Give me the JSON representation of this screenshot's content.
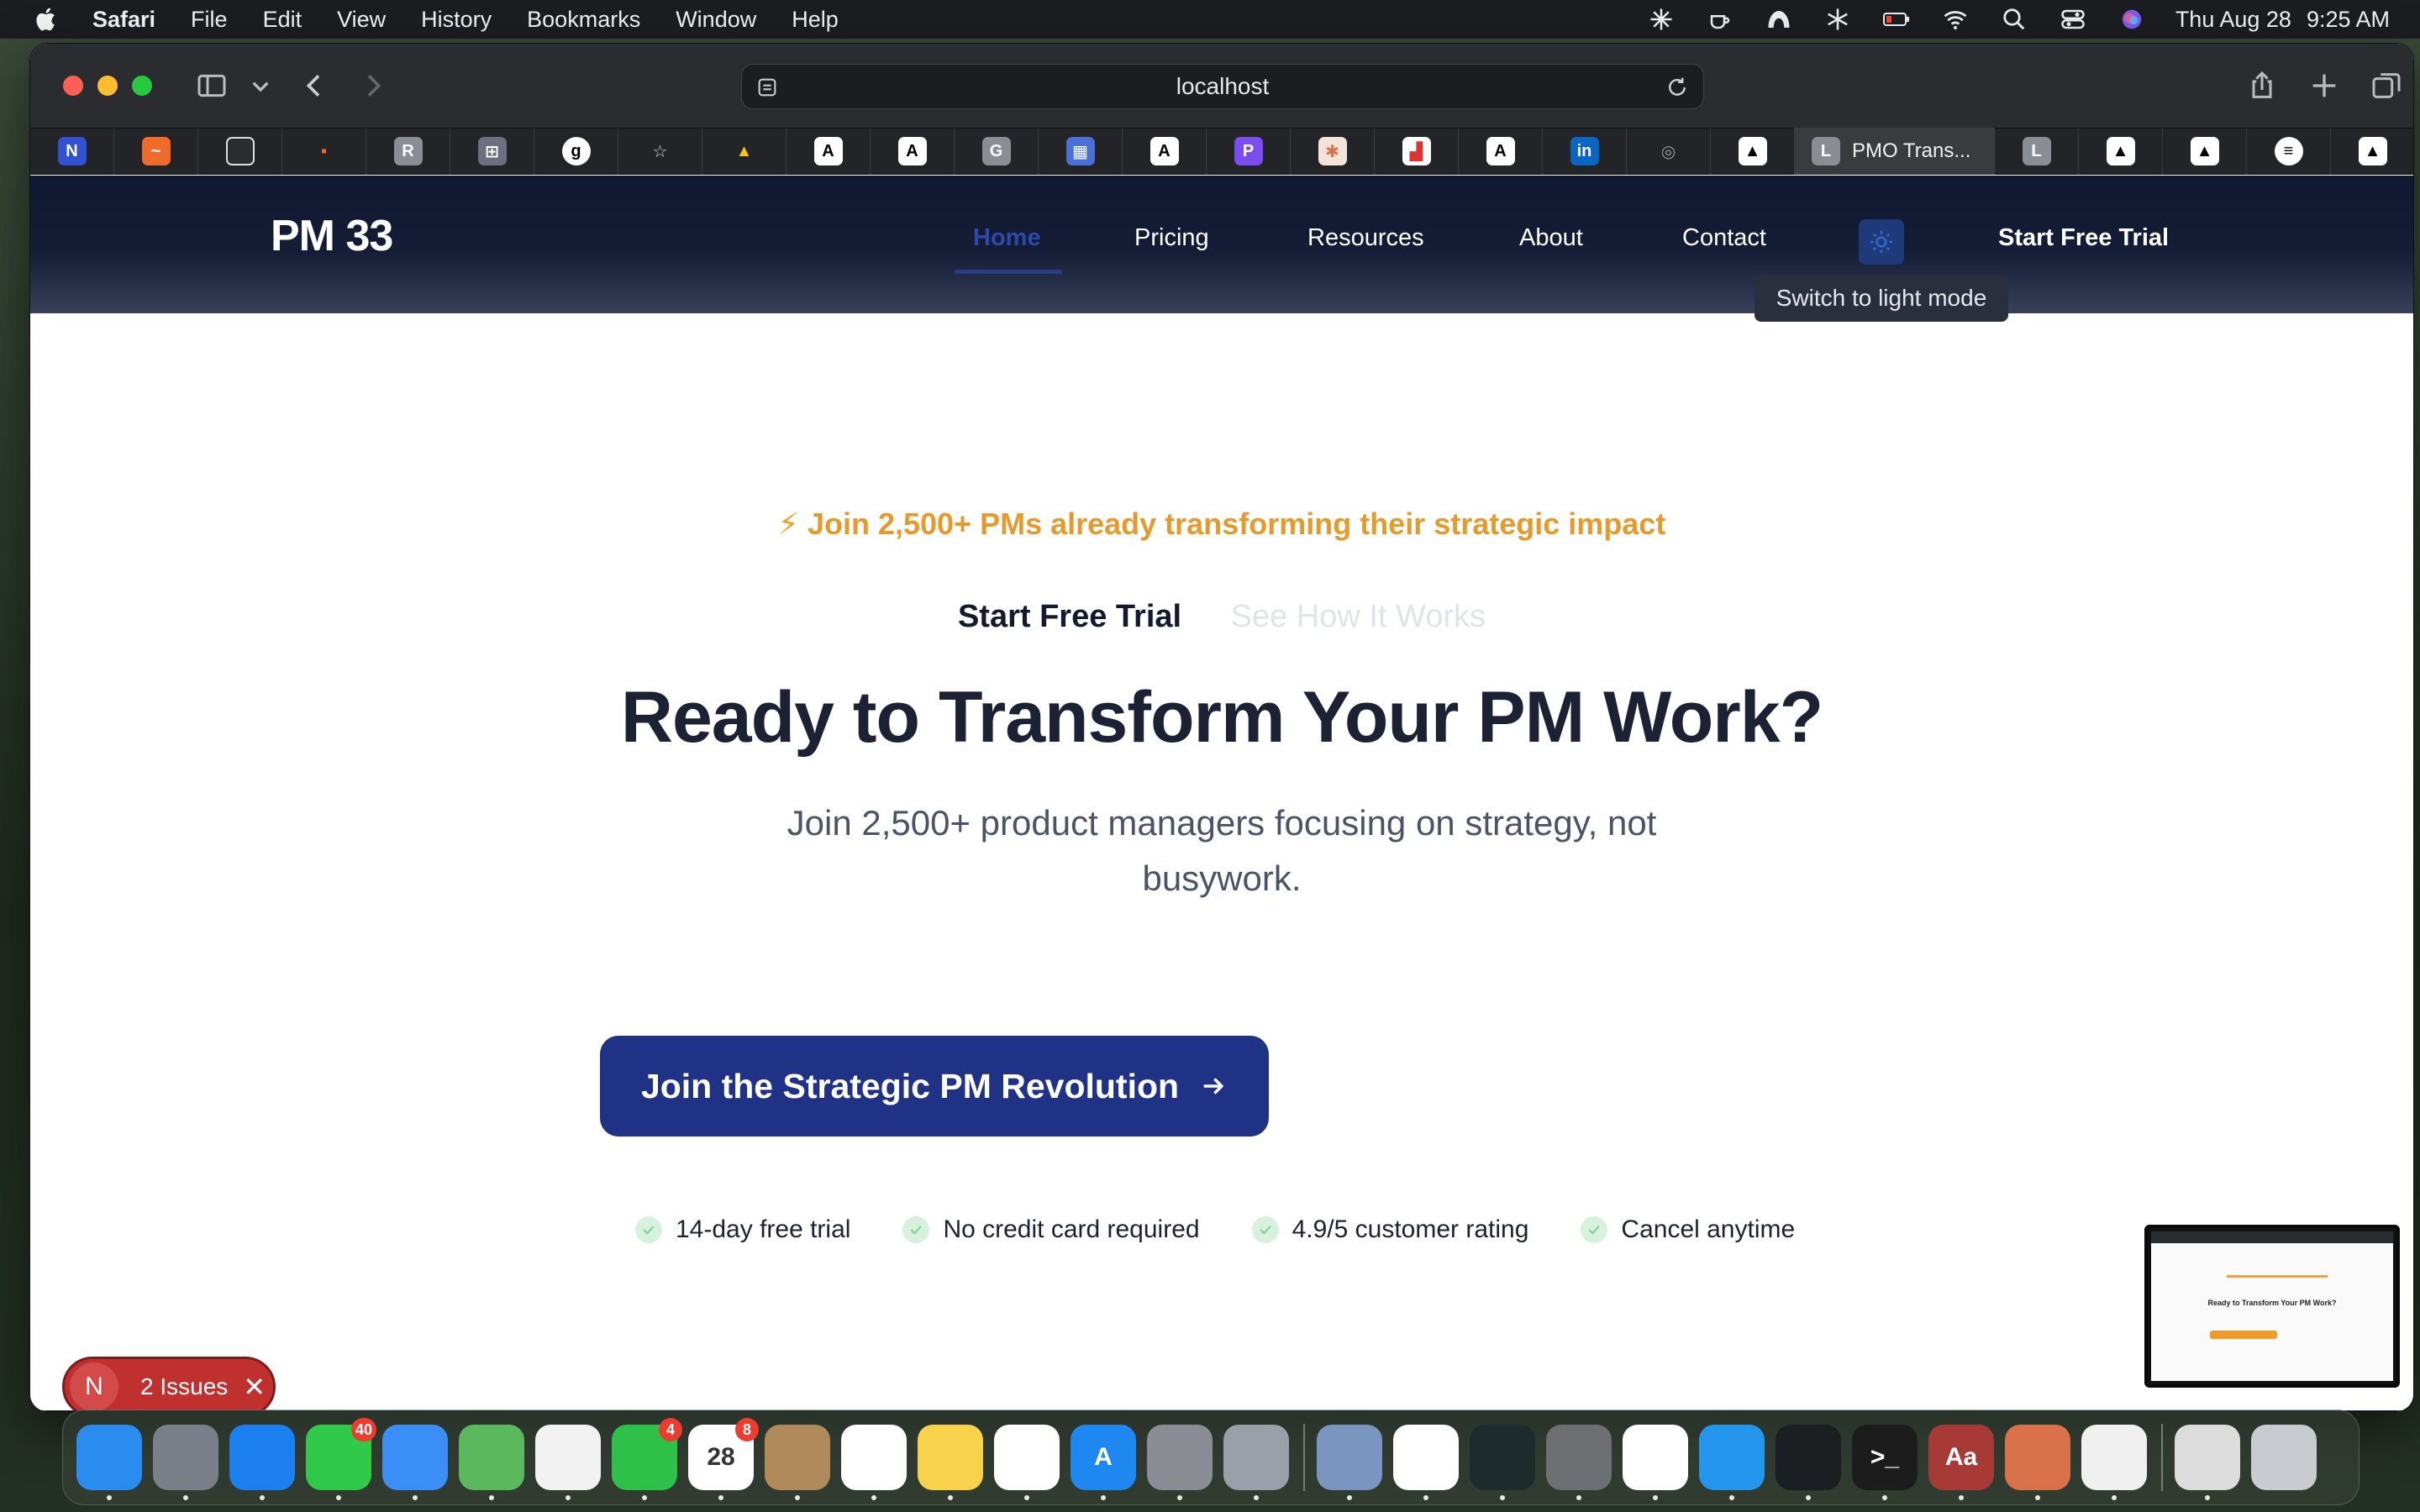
{
  "menubar": {
    "app_name": "Safari",
    "menus": [
      "File",
      "Edit",
      "View",
      "History",
      "Bookmarks",
      "Window",
      "Help"
    ],
    "status_icons": [
      "sparkle-icon",
      "coffee-icon",
      "arch-icon",
      "snowflake-icon",
      "battery-icon",
      "wifi-icon",
      "search-icon",
      "control-center-icon",
      "siri-icon"
    ],
    "date": "Thu Aug 28",
    "time": "9:25 AM"
  },
  "browser": {
    "url": "localhost",
    "active_tab_label": "PMO Trans...",
    "favorites_icons": [
      "n-icon",
      "zig-icon",
      "scan-icon",
      "dots-icon",
      "r-icon",
      "grid-icon",
      "g-icon",
      "star-icon",
      "drive-icon",
      "a-icon",
      "a-icon",
      "g-gray-icon",
      "blocks-icon",
      "a-icon",
      "p-icon",
      "burst-icon",
      "chart-icon",
      "a-icon",
      "linkedin-icon",
      "compass-icon",
      "triangle-icon",
      "l-icon",
      "triangle-icon",
      "triangle-icon",
      "spotify-icon",
      "triangle-icon"
    ]
  },
  "site": {
    "logo": "PM 33",
    "nav": {
      "home": "Home",
      "pricing": "Pricing",
      "resources": "Resources",
      "about": "About",
      "contact": "Contact",
      "cta": "Start Free Trial"
    },
    "tooltip": "Switch to light mode"
  },
  "hero": {
    "banner": "Join 2,500+ PMs already transforming their strategic impact",
    "banner_icon": "lightning-icon",
    "link_trial": "Start Free Trial",
    "link_how": "See How It Works",
    "title": "Ready to Transform Your PM Work?",
    "subtitle": "Join 2,500+ product managers focusing on strategy, not busywork.",
    "cta": "Join the Strategic PM Revolution",
    "features": [
      "14-day free trial",
      "No credit card required",
      "4.9/5 customer rating",
      "Cancel anytime"
    ]
  },
  "devtools": {
    "letter": "N",
    "issues": "2 Issues"
  },
  "dock": {
    "apps": [
      {
        "name": "finder",
        "color": "#2b8cf0",
        "label": ""
      },
      {
        "name": "launchpad",
        "color": "#7a7f8a",
        "label": ""
      },
      {
        "name": "safari",
        "color": "#1c7ff0",
        "label": ""
      },
      {
        "name": "messages",
        "color": "#30c94a",
        "label": "",
        "badge": "40"
      },
      {
        "name": "mail",
        "color": "#3b8ef5",
        "label": ""
      },
      {
        "name": "maps",
        "color": "#5cb85c",
        "label": ""
      },
      {
        "name": "photos",
        "color": "#f2f2f2",
        "label": ""
      },
      {
        "name": "facetime",
        "color": "#2fc04a",
        "label": "",
        "badge": "4"
      },
      {
        "name": "calendar",
        "color": "#ffffff",
        "label": "28",
        "badge": "8"
      },
      {
        "name": "contacts",
        "color": "#b08a5a",
        "label": ""
      },
      {
        "name": "reminders",
        "color": "#ffffff",
        "label": ""
      },
      {
        "name": "notes",
        "color": "#f7d24a",
        "label": ""
      },
      {
        "name": "freeform",
        "color": "#ffffff",
        "label": ""
      },
      {
        "name": "app-store",
        "color": "#1e88f0",
        "label": "A"
      },
      {
        "name": "system-settings",
        "color": "#8a8d93",
        "label": ""
      },
      {
        "name": "iphone-mirroring",
        "color": "#9aa0a8",
        "label": ""
      },
      {
        "name": "preview",
        "color": "#7a95c0",
        "label": ""
      },
      {
        "name": "chrome",
        "color": "#ffffff",
        "label": ""
      },
      {
        "name": "perplexity",
        "color": "#1c2c2c",
        "label": ""
      },
      {
        "name": "calculator",
        "color": "#6d6f73",
        "label": ""
      },
      {
        "name": "arc",
        "color": "#ffffff",
        "label": ""
      },
      {
        "name": "docker",
        "color": "#2496ed",
        "label": ""
      },
      {
        "name": "activity-monitor",
        "color": "#1c1f22",
        "label": ""
      },
      {
        "name": "terminal",
        "color": "#1c1c1c",
        "label": ">_"
      },
      {
        "name": "dictionary",
        "color": "#a73a36",
        "label": "Aa"
      },
      {
        "name": "claude",
        "color": "#d9714a",
        "label": ""
      },
      {
        "name": "textedit",
        "color": "#f0f0f0",
        "label": ""
      },
      {
        "name": "files",
        "color": "#dcdcdc",
        "label": ""
      },
      {
        "name": "trash",
        "color": "#c8cbd0",
        "label": ""
      }
    ]
  }
}
